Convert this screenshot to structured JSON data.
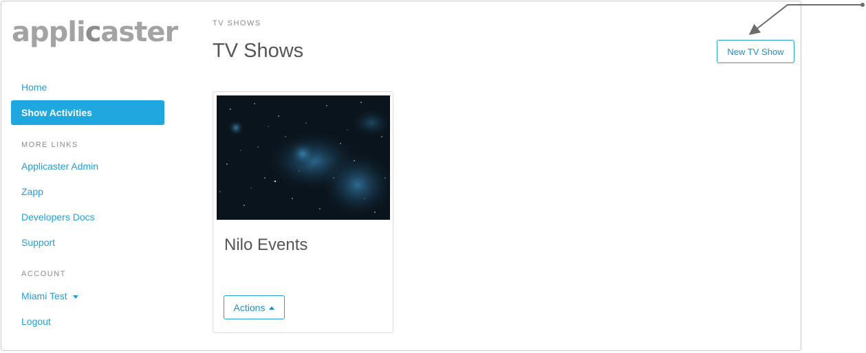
{
  "brand": {
    "logo_text_a": "appli",
    "logo_text_b": "c",
    "logo_text_c": "aster"
  },
  "sidebar": {
    "home_label": "Home",
    "active_label": "Show Activities",
    "more_links_heading": "MORE LINKS",
    "more_links": [
      "Applicaster Admin",
      "Zapp",
      "Developers Docs",
      "Support"
    ],
    "account_heading": "ACCOUNT",
    "account_user": "Miami Test",
    "logout_label": "Logout"
  },
  "main": {
    "breadcrumb": "TV SHOWS",
    "title": "TV Shows",
    "new_button_label": "New TV Show"
  },
  "cards": [
    {
      "title": "Nilo Events",
      "actions_label": "Actions"
    }
  ],
  "colors": {
    "accent": "#1fa8e0",
    "link": "#1e9fd8",
    "annotation": "#6b6b6b"
  }
}
